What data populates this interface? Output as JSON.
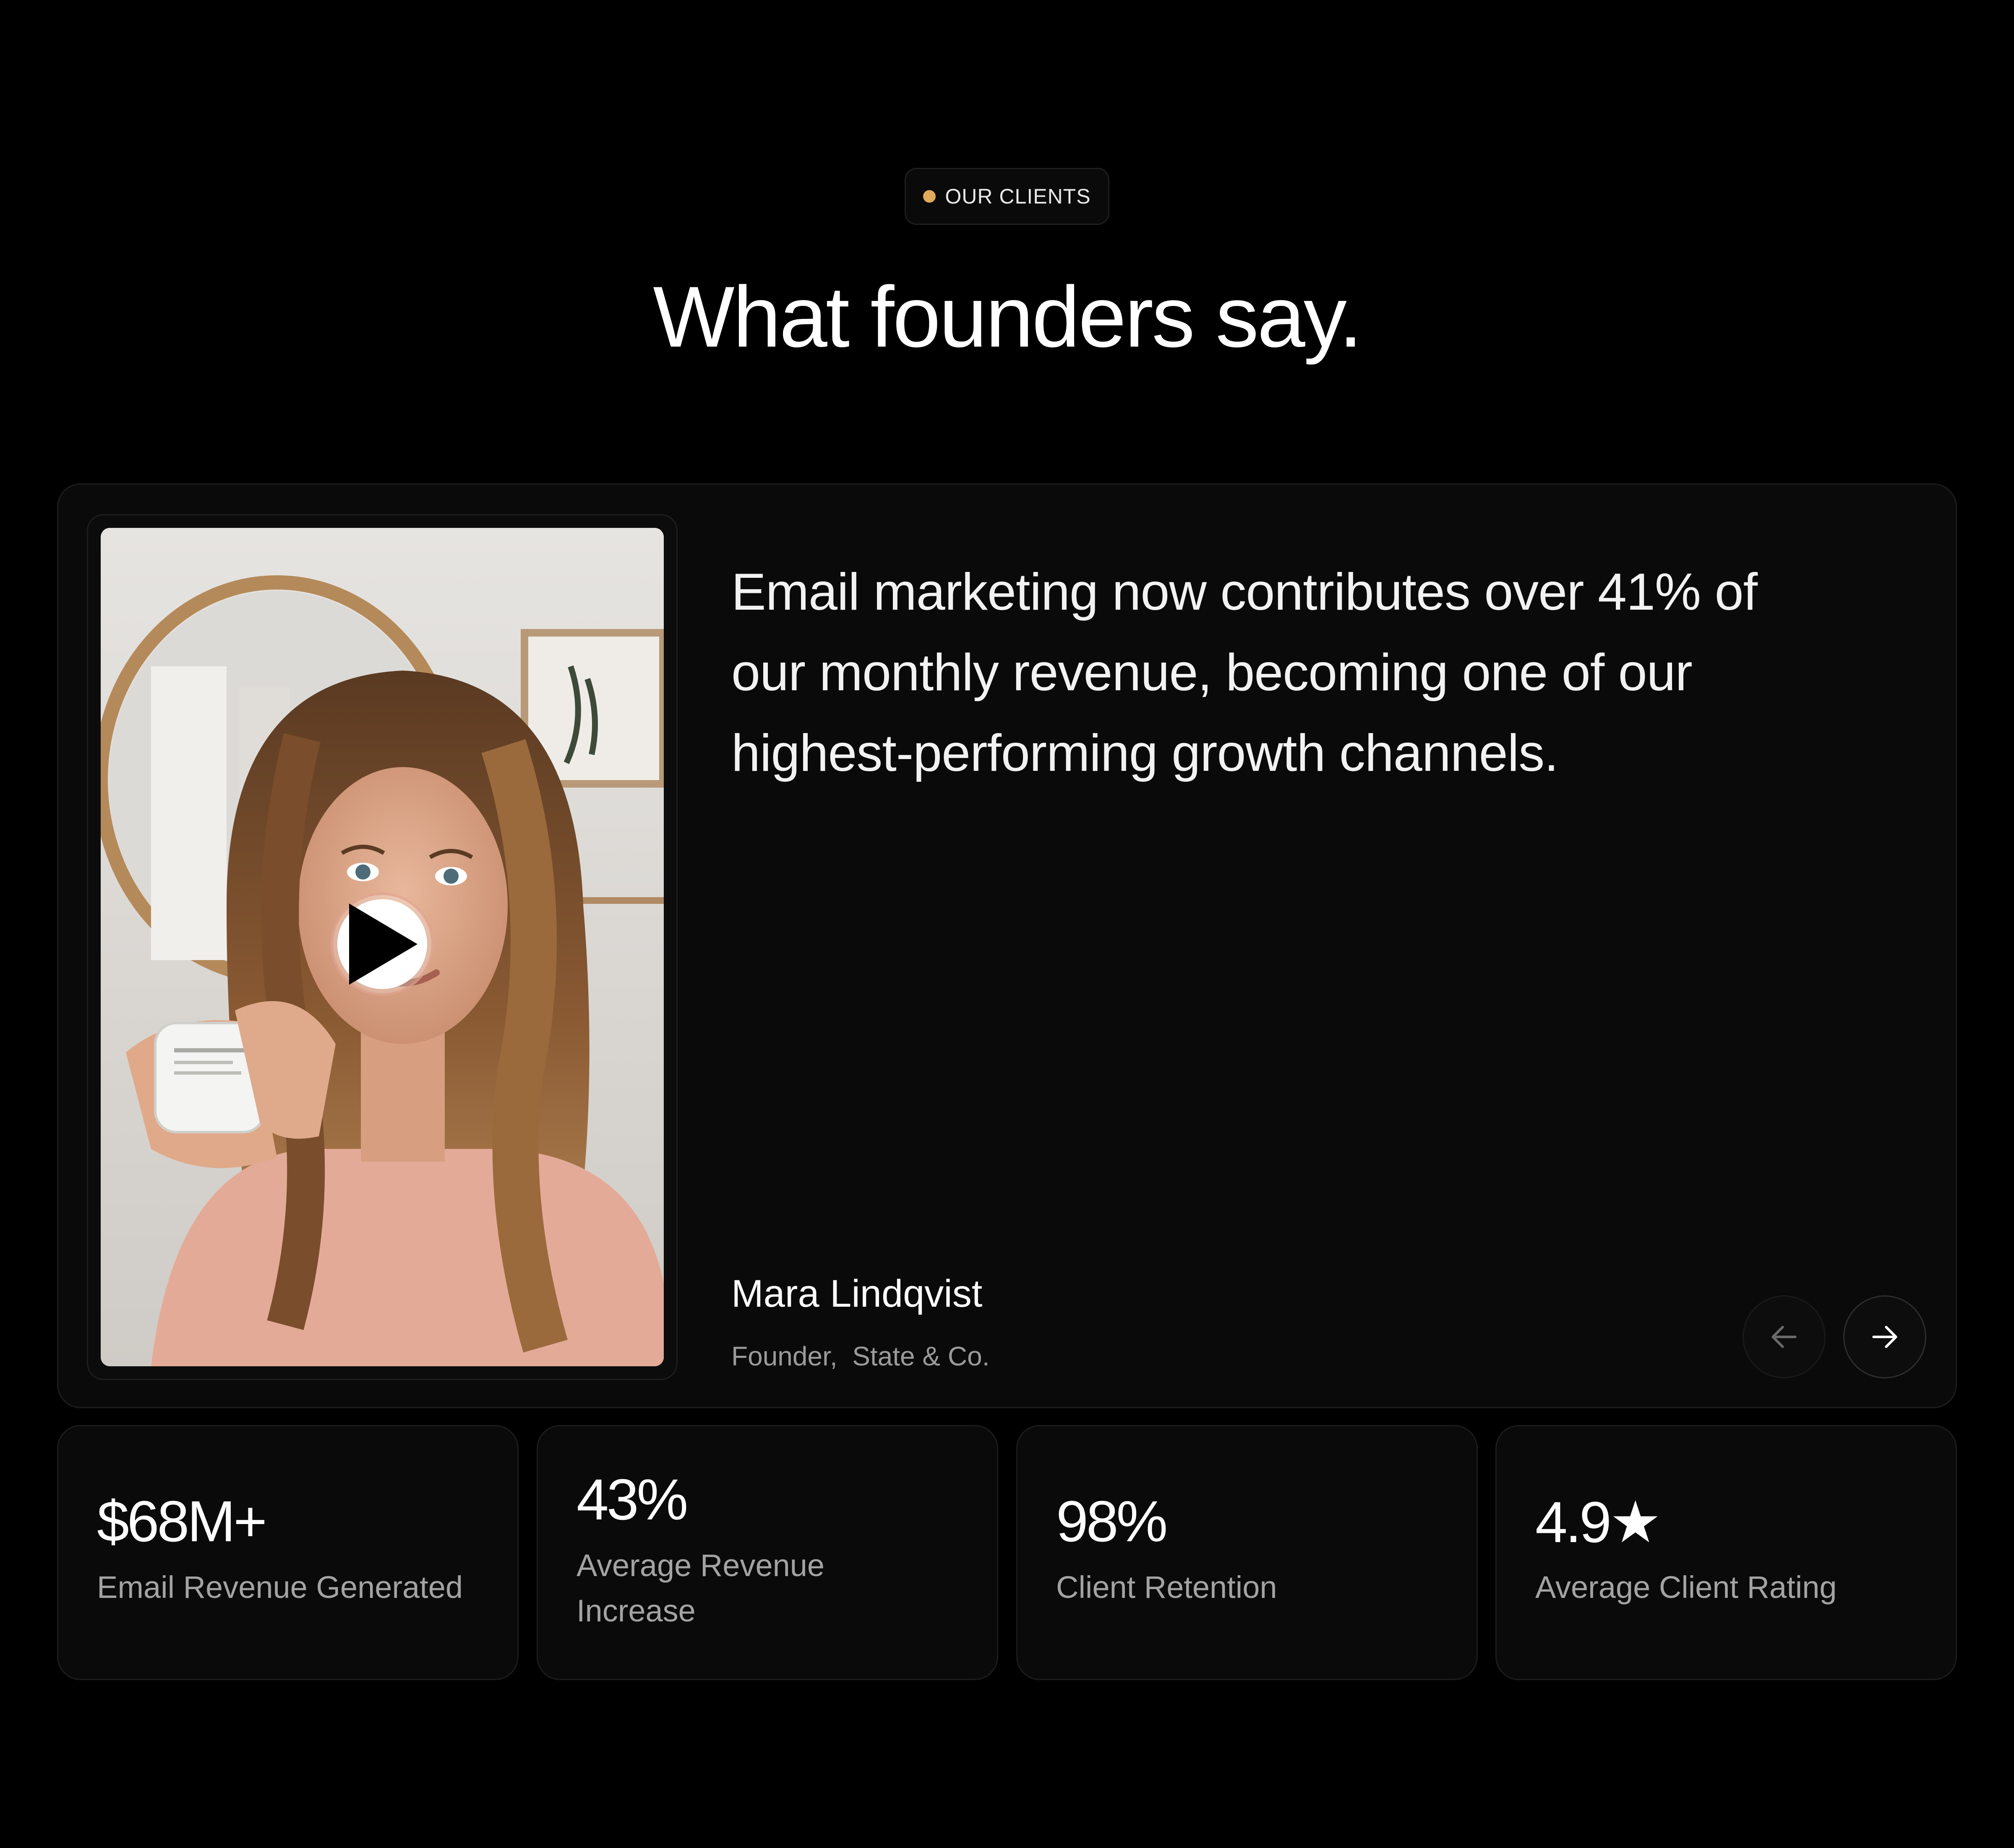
{
  "header": {
    "eyebrow": "OUR CLIENTS",
    "title": "What founders say."
  },
  "testimonial": {
    "quote": "Email marketing now contributes over 41% of our monthly revenue, becoming one of our highest-performing growth channels.",
    "author_name": "Mara Lindqvist",
    "author_role": "Founder,  State & Co.",
    "video": {
      "icon": "play-icon"
    },
    "navigation": {
      "prev_icon": "arrow-left-icon",
      "next_icon": "arrow-right-icon"
    }
  },
  "stats": [
    {
      "value": "$68M+",
      "label": "Email Revenue Generated"
    },
    {
      "value": "43%",
      "label": "Average Revenue Increase"
    },
    {
      "value": "98%",
      "label": "Client Retention"
    },
    {
      "value": "4.9★",
      "label": "Average Client Rating"
    }
  ],
  "colors": {
    "background": "#000000",
    "card": "#0a0a0a",
    "accent_dot": "#e0a95c",
    "muted_text": "#a3a3a3"
  }
}
